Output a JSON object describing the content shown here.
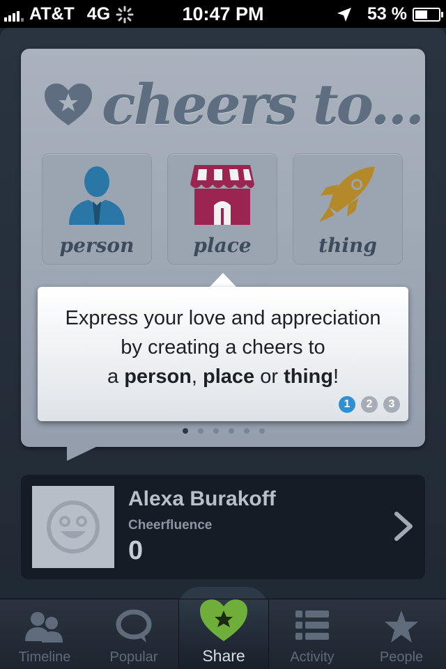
{
  "status_bar": {
    "carrier": "AT&T",
    "network": "4G",
    "time": "10:47 PM",
    "battery": "53 %"
  },
  "headline": "cheers to...",
  "categories": [
    {
      "label": "person",
      "icon": "person-icon",
      "color": "#2a76a6"
    },
    {
      "label": "place",
      "icon": "storefront-icon",
      "color": "#9b2451"
    },
    {
      "label": "thing",
      "icon": "rocket-icon",
      "color": "#b4892a"
    }
  ],
  "tooltip": {
    "line1": "Express your love and appreciation",
    "line2": "by creating a cheers to",
    "line3_prefix": "a ",
    "person": "person",
    "comma": ", ",
    "place": "place",
    "or": " or ",
    "thing": "thing",
    "bang": "!",
    "steps": [
      "1",
      "2",
      "3"
    ],
    "active_step": "1"
  },
  "page_dots": {
    "count": 6,
    "active": 1
  },
  "profile": {
    "name": "Alexa Burakoff",
    "cheerfluence_label": "Cheerfluence",
    "cheerfluence_value": "0"
  },
  "tabs": [
    {
      "label": "Timeline",
      "icon": "people-icon"
    },
    {
      "label": "Popular",
      "icon": "speech-bubble-icon"
    },
    {
      "label": "Share",
      "icon": "heart-star-icon",
      "active": true
    },
    {
      "label": "Activity",
      "icon": "list-icon"
    },
    {
      "label": "People",
      "icon": "star-icon"
    }
  ],
  "colors": {
    "accent_blue": "#2f8fd0",
    "share_green": "#6fae3a",
    "card_gray": "#a9b2bd",
    "dark_bg": "#1e2630"
  }
}
